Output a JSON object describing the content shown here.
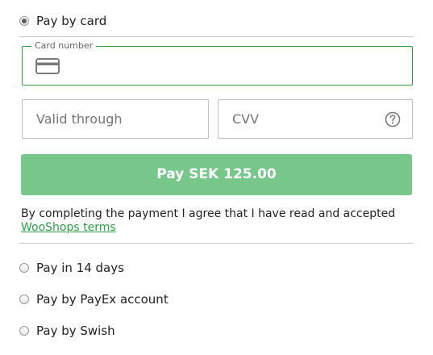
{
  "payment_methods": {
    "card": {
      "label": "Pay by card",
      "selected": true
    },
    "invoice": {
      "label": "Pay in 14 days",
      "selected": false
    },
    "payex": {
      "label": "Pay by PayEx account",
      "selected": false
    },
    "swish": {
      "label": "Pay by Swish",
      "selected": false
    }
  },
  "card_form": {
    "card_number": {
      "legend": "Card number",
      "value": "",
      "icon": "credit-card-icon"
    },
    "valid_through": {
      "placeholder": "Valid through",
      "value": ""
    },
    "cvv": {
      "placeholder": "CVV",
      "value": "",
      "help_icon": "question-circle-icon"
    },
    "pay_button_label": "Pay SEK 125.00"
  },
  "terms": {
    "text": "By completing the payment I agree that I have read and accepted",
    "link_text": "WooShops terms"
  },
  "colors": {
    "accent": "#2e9e44",
    "pay_button_bg": "#77c68a",
    "pay_button_text": "#ffffff",
    "border": "#bdbdbd"
  }
}
